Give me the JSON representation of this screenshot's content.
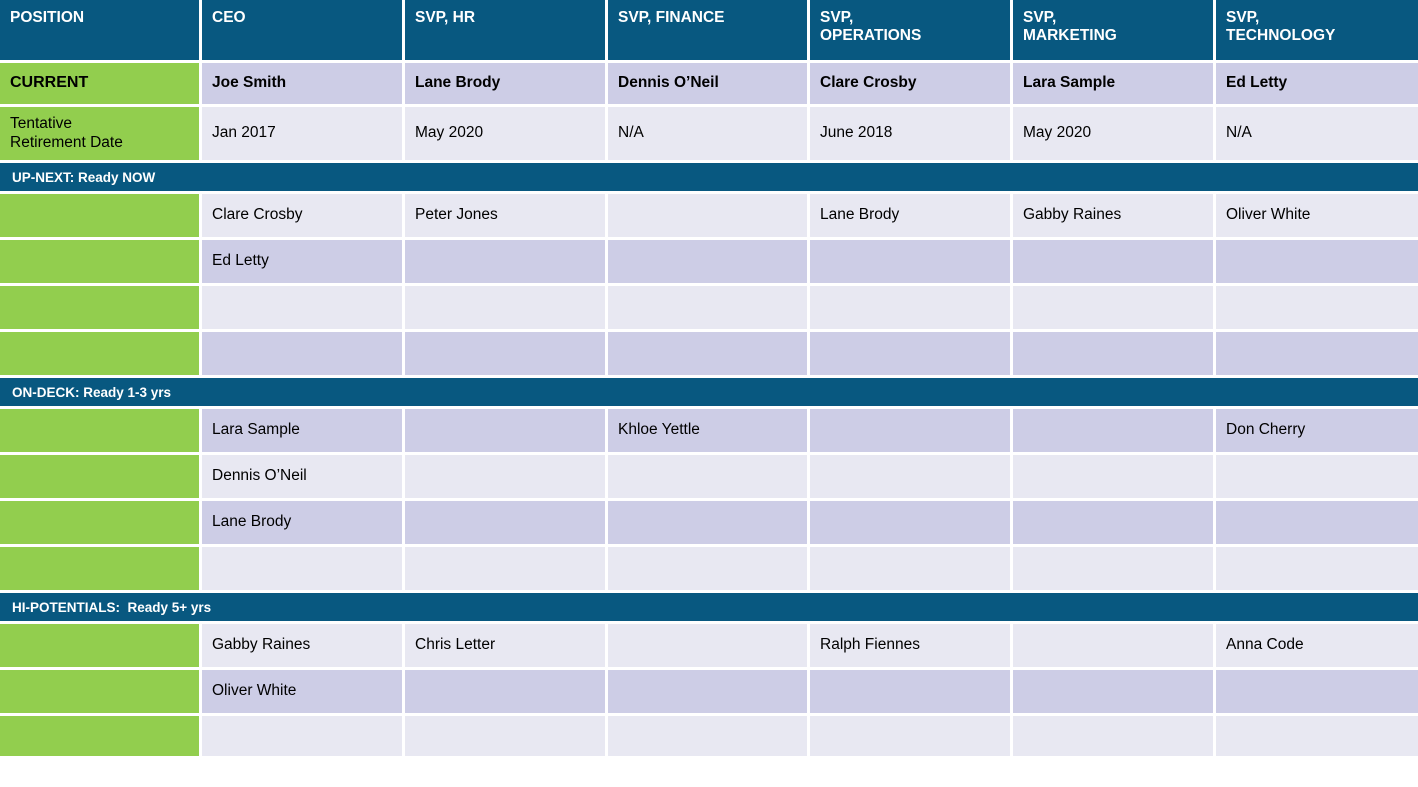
{
  "colors": {
    "header_blue": "#085880",
    "green": "#92CE4E",
    "lavender_dark": "#CDCDE6",
    "lavender_light": "#E8E8F2",
    "grid_white": "#FFFFFF",
    "text_dark": "#000000",
    "text_light": "#FFFFFF"
  },
  "columns": [
    {
      "key": "position",
      "label": "POSITION"
    },
    {
      "key": "ceo",
      "label": "CEO"
    },
    {
      "key": "svp_hr",
      "label": "SVP, HR"
    },
    {
      "key": "svp_fin",
      "label": "SVP, FINANCE"
    },
    {
      "key": "svp_ops",
      "label": "SVP,\nOPERATIONS"
    },
    {
      "key": "svp_mkt",
      "label": "SVP,\nMARKETING"
    },
    {
      "key": "svp_tech",
      "label": "SVP,\nTECHNOLOGY"
    }
  ],
  "current_row": {
    "label": "CURRENT",
    "values": [
      "Joe Smith",
      "Lane Brody",
      "Dennis O’Neil",
      "Clare Crosby",
      "Lara Sample",
      "Ed Letty"
    ]
  },
  "retirement_row": {
    "label": "Tentative\nRetirement Date",
    "values": [
      "Jan 2017",
      "May 2020",
      "N/A",
      "June 2018",
      "May 2020",
      "N/A"
    ]
  },
  "sections": [
    {
      "id": "up-next",
      "banner": "UP-NEXT: Ready NOW",
      "start_shade": "light",
      "rows": [
        {
          "label": "",
          "values": [
            "Clare Crosby",
            "Peter Jones",
            "",
            "Lane Brody",
            "Gabby Raines",
            "Oliver White"
          ]
        },
        {
          "label": "",
          "values": [
            "Ed Letty",
            "",
            "",
            "",
            "",
            ""
          ]
        },
        {
          "label": "",
          "values": [
            "",
            "",
            "",
            "",
            "",
            ""
          ]
        },
        {
          "label": "",
          "values": [
            "",
            "",
            "",
            "",
            "",
            ""
          ]
        }
      ]
    },
    {
      "id": "on-deck",
      "banner": "ON-DECK: Ready 1-3 yrs",
      "start_shade": "dark",
      "rows": [
        {
          "label": "",
          "values": [
            "Lara Sample",
            "",
            "Khloe Yettle",
            "",
            "",
            "Don Cherry"
          ]
        },
        {
          "label": "",
          "values": [
            "Dennis O’Neil",
            "",
            "",
            "",
            "",
            ""
          ]
        },
        {
          "label": "",
          "values": [
            "Lane Brody",
            "",
            "",
            "",
            "",
            ""
          ]
        },
        {
          "label": "",
          "values": [
            "",
            "",
            "",
            "",
            "",
            ""
          ]
        }
      ]
    },
    {
      "id": "hi-potentials",
      "banner": "HI-POTENTIALS:  Ready 5+ yrs",
      "start_shade": "light",
      "rows": [
        {
          "label": "",
          "values": [
            "Gabby Raines",
            "Chris Letter",
            "",
            "Ralph Fiennes",
            "",
            "Anna Code"
          ]
        },
        {
          "label": "",
          "values": [
            "Oliver White",
            "",
            "",
            "",
            "",
            ""
          ]
        },
        {
          "label": "",
          "values": [
            "",
            "",
            "",
            "",
            "",
            ""
          ]
        }
      ]
    }
  ]
}
